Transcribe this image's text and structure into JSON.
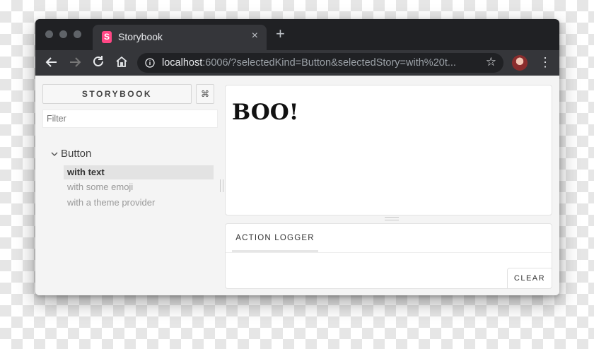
{
  "browser": {
    "tab_title": "Storybook",
    "favicon_letter": "S",
    "favicon_color": "#ff4785",
    "close_glyph": "×",
    "new_tab_glyph": "+",
    "url_host": "localhost",
    "url_rest": ":6006/?selectedKind=Button&selectedStory=with%20t...",
    "star_glyph": "☆",
    "menu_glyph": "⋮"
  },
  "sidebar": {
    "brand_label": "STORYBOOK",
    "shortcut_label": "⌘",
    "filter_placeholder": "Filter",
    "kind_chevron": "⌄",
    "kind_label": "Button",
    "stories": [
      {
        "label": "with text",
        "active": true
      },
      {
        "label": "with some emoji",
        "active": false
      },
      {
        "label": "with a theme provider",
        "active": false
      }
    ]
  },
  "preview": {
    "heading": "BOO!"
  },
  "addons": {
    "tab_label": "ACTION LOGGER",
    "clear_label": "CLEAR"
  }
}
